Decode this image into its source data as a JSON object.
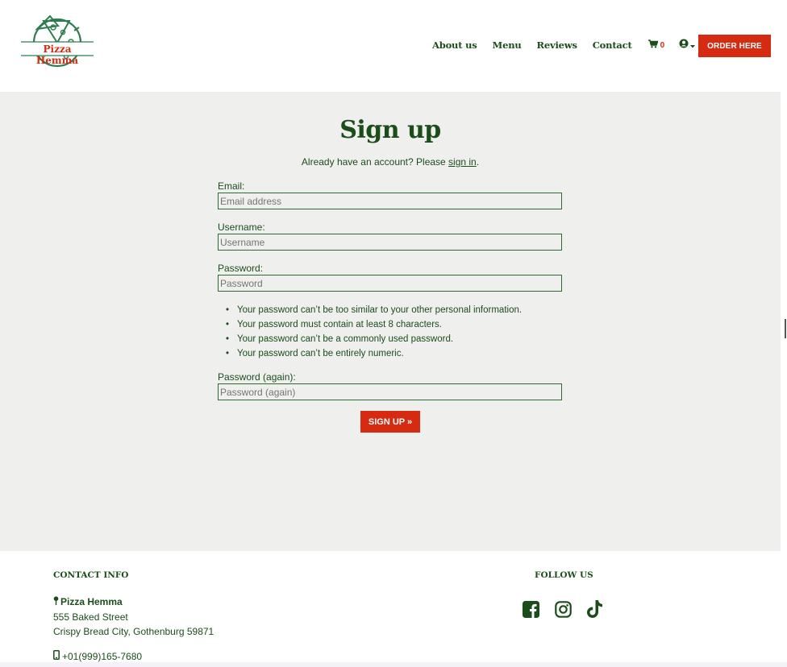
{
  "header": {
    "logo_text": "Pizza Hemma",
    "nav": [
      "About us",
      "Menu",
      "Reviews",
      "Contact"
    ],
    "cart_count": "0",
    "order_button": "ORDER HERE"
  },
  "main": {
    "title": "Sign up",
    "already_prefix": "Already have an account? Please ",
    "signin_link": "sign in",
    "already_suffix": ".",
    "fields": {
      "email_label": "Email:",
      "email_placeholder": "Email address",
      "username_label": "Username:",
      "username_placeholder": "Username",
      "password_label": "Password:",
      "password_placeholder": "Password",
      "password2_label": "Password (again):",
      "password2_placeholder": "Password (again)"
    },
    "rules": [
      "Your password can’t be too similar to your other personal information.",
      "Your password must contain at least 8 characters.",
      "Your password can’t be a commonly used password.",
      "Your password can’t be entirely numeric."
    ],
    "signup_button": "SIGN UP »"
  },
  "footer": {
    "contact_heading": "CONTACT INFO",
    "business_name": "Pizza Hemma",
    "address_line1": "555 Baked Street",
    "address_line2": "Crispy Bread City, Gothenburg 59871",
    "phone": "+01(999)165-7680",
    "follow_heading": "FOLLOW US",
    "social_icons": [
      "facebook-icon",
      "instagram-icon",
      "tiktok-icon"
    ]
  },
  "colors": {
    "brand_green": "#1b4d1b",
    "brand_red": "#d42b12",
    "main_bg": "#efefed"
  }
}
